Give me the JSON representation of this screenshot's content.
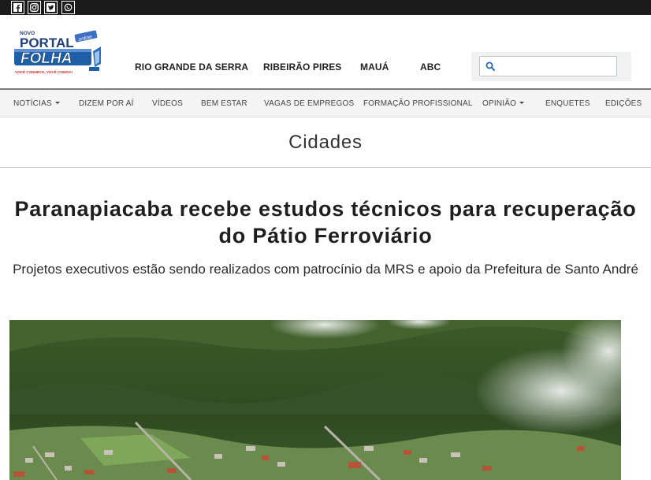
{
  "social": [
    {
      "name": "facebook-icon"
    },
    {
      "name": "instagram-icon"
    },
    {
      "name": "twitter-icon"
    },
    {
      "name": "whatsapp-icon"
    }
  ],
  "logo": {
    "novo": "NOVO",
    "portal": "PORTAL",
    "folha": "FOLHA",
    "badge": "online",
    "tagline": "VOCÊ CONHECE, VOCÊ CONFIA!"
  },
  "cities": [
    "RIO GRANDE DA SERRA",
    "RIBEIRÃO PIRES",
    "MAUÁ",
    "ABC"
  ],
  "search": {
    "placeholder": ""
  },
  "nav": [
    "NOTÍCIAS",
    "DIZEM POR AÍ",
    "VÍDEOS",
    "BEM ESTAR",
    "VAGAS DE EMPREGOS",
    "FORMAÇÃO PROFISSIONAL",
    "OPINIÃO",
    "ENQUETES",
    "EDIÇÕES"
  ],
  "section": {
    "title": "Cidades"
  },
  "article": {
    "headline": "Paranapiacaba recebe estudos técnicos para recuperação do Pátio Ferroviário",
    "subheadline": "Projetos executivos estão sendo realizados com patrocínio da MRS e apoio da Prefeitura de Santo André"
  },
  "colors": {
    "topbar": "#1b1b1b",
    "logo_blue": "#1f5fa8",
    "logo_red": "#d62a2a",
    "nav_bg": "#f4f4f4"
  }
}
